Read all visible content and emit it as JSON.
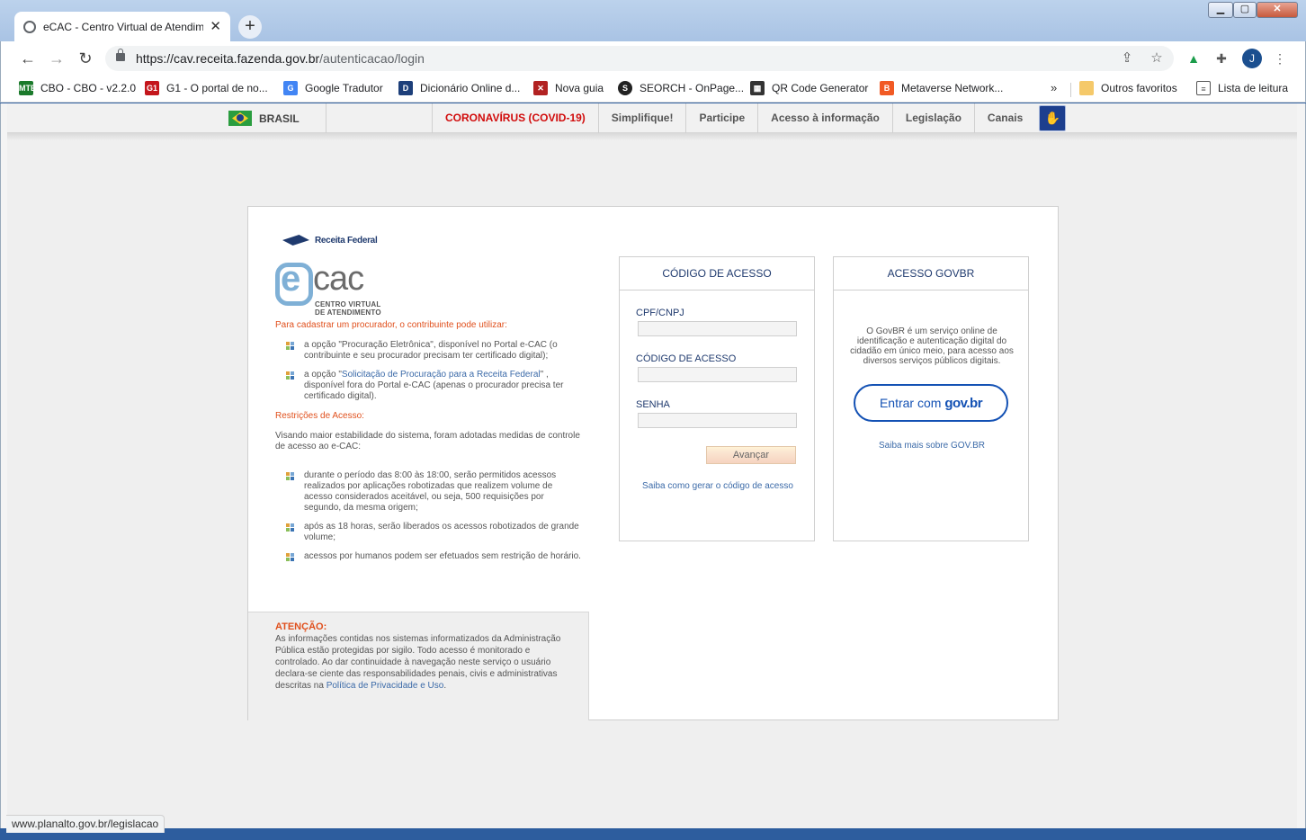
{
  "browser": {
    "tab_title": "eCAC - Centro Virtual de Atendimento",
    "url_host": "https://cav.receita.fazenda.gov.br",
    "url_path": "/autenticacao/login",
    "profile_initial": "J",
    "status_url": "www.planalto.gov.br/legislacao",
    "bookmarks": [
      {
        "label": "CBO - CBO - v2.2.0",
        "color": "#1b7a2b"
      },
      {
        "label": "G1 - O portal de no...",
        "color": "#c4161c"
      },
      {
        "label": "Google Tradutor",
        "color": "#4285f4"
      },
      {
        "label": "Dicionário Online d...",
        "color": "#1d3f7a"
      },
      {
        "label": "Nova guia",
        "color": "#b22222"
      },
      {
        "label": "SEORCH - OnPage...",
        "color": "#222222"
      },
      {
        "label": "QR Code Generator",
        "color": "#333333"
      },
      {
        "label": "Metaverse Network...",
        "color": "#f15a24"
      }
    ],
    "bookmarks_more": "»",
    "other_favorites": "Outros favoritos",
    "reading_list": "Lista de leitura"
  },
  "govbar": {
    "country": "BRASIL",
    "items": [
      "CORONAVÍRUS (COVID-19)",
      "Simplifique!",
      "Participe",
      "Acesso à informação",
      "Legislação",
      "Canais"
    ]
  },
  "brand": {
    "receita": "Receita Federal",
    "ecac_e": "e",
    "ecac_cac": "cac",
    "ecac_sub1": "CENTRO VIRTUAL",
    "ecac_sub2": "DE ATENDIMENTO"
  },
  "info": {
    "intro": "Para cadastrar um procurador, o contribuinte pode utilizar:",
    "opt1": "a opção \"Procuração Eletrônica\", disponível no Portal e-CAC (o contribuinte e seu procurador precisam ter certificado digital);",
    "opt2_pre": "a opção \"",
    "opt2_link": "Solicitação de Procuração para a Receita Federal",
    "opt2_post": "\" , disponível fora do Portal e-CAC (apenas o procurador precisa ter certificado digital).",
    "restrictions_title": "Restrições de Acesso:",
    "restrictions_text": "Visando maior estabilidade do sistema, foram adotadas medidas de controle de acesso ao e-CAC:",
    "r1": "durante o período das 8:00 às 18:00, serão permitidos acessos realizados por aplicações robotizadas que realizem volume de acesso considerados aceitável, ou seja, 500 requisições por segundo, da mesma origem;",
    "r2": "após as 18 horas, serão liberados os acessos robotizados de grande volume;",
    "r3": "acessos por humanos podem ser efetuados sem restrição de horário."
  },
  "attention": {
    "title": "ATENÇÃO:",
    "text": "As informações contidas nos sistemas informatizados da Administração Pública estão protegidas por sigilo. Todo acesso é monitorado e controlado. Ao dar continuidade à navegação neste serviço o usuário declara-se ciente das responsabilidades penais, civis e administrativas descritas na ",
    "link": "Política de Privacidade e Uso",
    "end": "."
  },
  "code_panel": {
    "title": "CÓDIGO DE ACESSO",
    "cpf_label": "CPF/CNPJ",
    "code_label": "CÓDIGO DE ACESSO",
    "password_label": "SENHA",
    "submit": "Avançar",
    "help": "Saiba como gerar o código de acesso"
  },
  "gov_panel": {
    "title": "ACESSO GOVBR",
    "description": "O GovBR é um serviço online de identificação e autenticação digital do cidadão em único meio, para acesso aos diversos serviços públicos digitais.",
    "button_pre": "Entrar com",
    "button_brand": "gov.br",
    "more": "Saiba mais sobre GOV.BR"
  }
}
